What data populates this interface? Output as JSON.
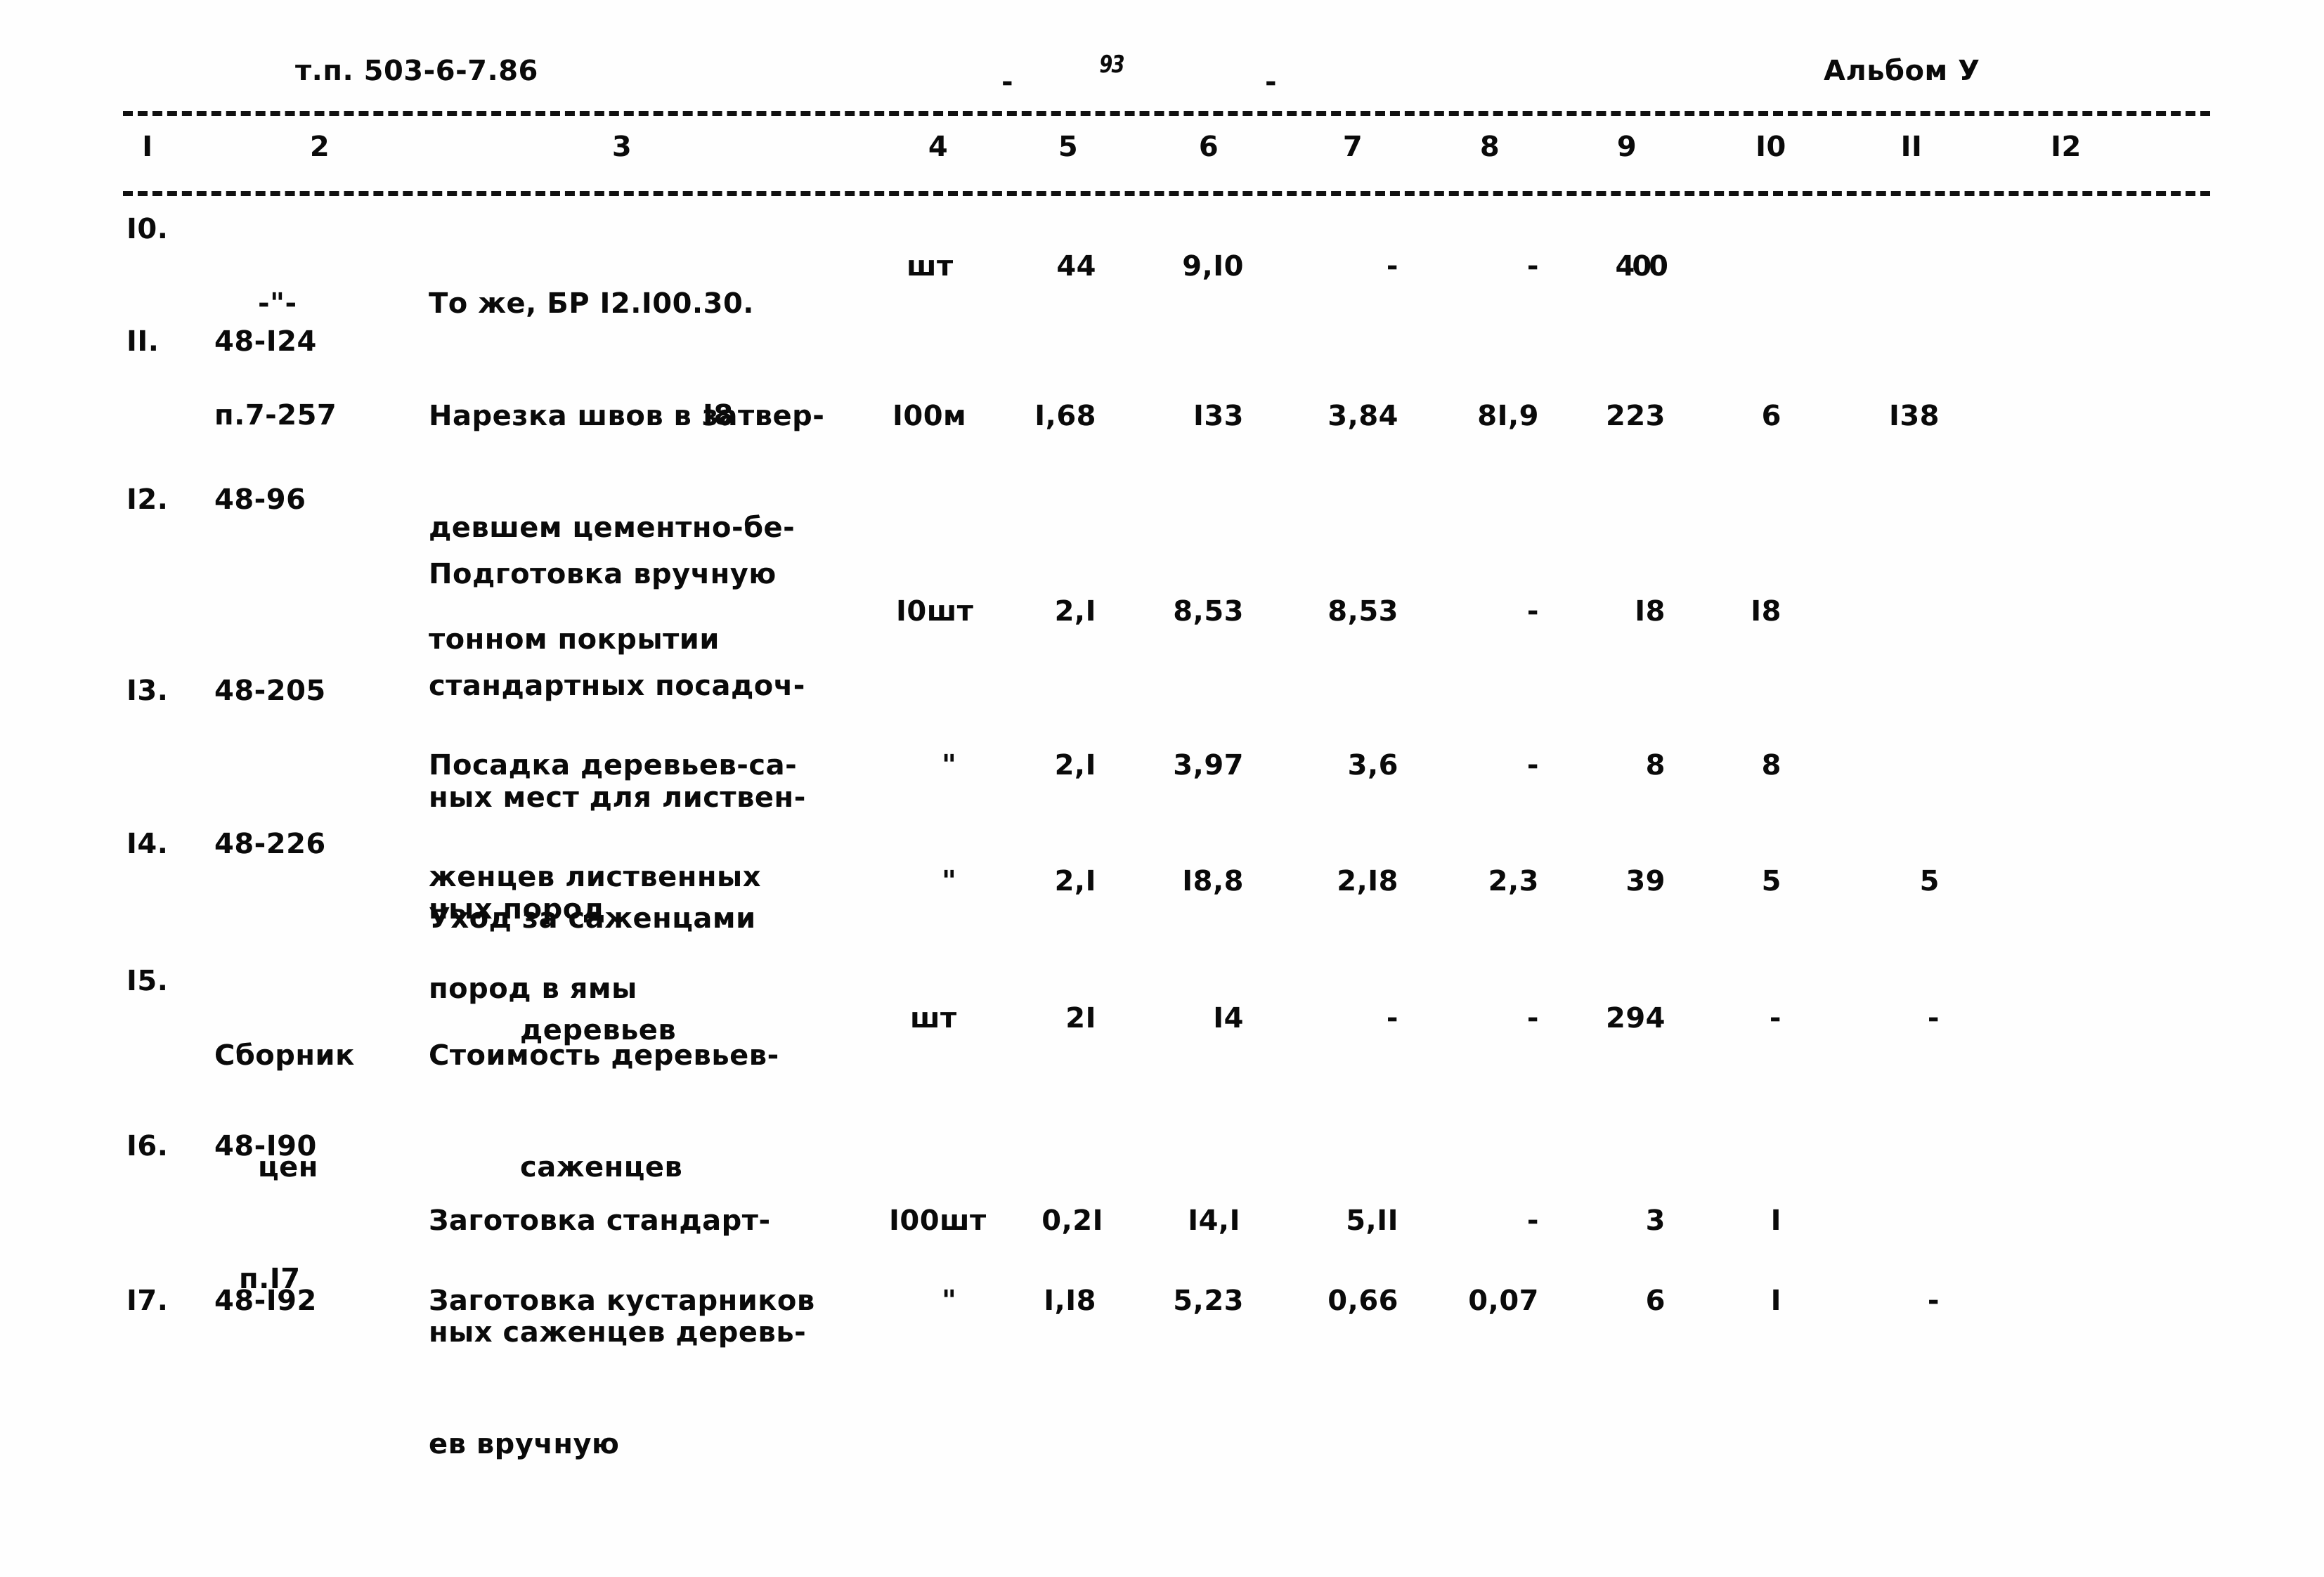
{
  "header": {
    "doc_code": "т.п. 503-6-7.86",
    "dash_left": "-",
    "page_number": "93",
    "dash_right": "-",
    "album": "Альбом У"
  },
  "table": {
    "column_numbers": [
      "I",
      "2",
      "3",
      "4",
      "5",
      "6",
      "7",
      "8",
      "9",
      "I0",
      "II",
      "I2"
    ],
    "rows": [
      {
        "num": "I0.",
        "code_line1": "-\"-",
        "code_line2": "п.7-257",
        "name_line1": "То же, БР I2.I00.30.",
        "name_line2": "I8",
        "unit": "шт",
        "c5": "44",
        "c6": "9,I0",
        "c7": "-",
        "c8": "-",
        "c9": "400",
        "c10": "",
        "c11": "",
        "c12": ""
      },
      {
        "num": "II.",
        "code_line1": "48-I24",
        "code_line2": "",
        "name_line1": "Нарезка швов в затвер-",
        "name_line2": "девшем цементно-бе-",
        "name_line3": "тонном покрытии",
        "unit": "I00м",
        "c5": "I,68",
        "c6": "I33",
        "c7": "3,84",
        "c8": "8I,9",
        "c9": "223",
        "c10": "6",
        "c11": "I38",
        "c12": ""
      },
      {
        "num": "I2.",
        "code_line1": "48-96",
        "code_line2": "",
        "name_line1": "Подготовка вручную",
        "name_line2": "стандартных посадоч-",
        "name_line3": "ных мест для листвен-",
        "name_line4": "ных пород",
        "unit": "I0шт",
        "c5": "2,I",
        "c6": "8,53",
        "c7": "8,53",
        "c8": "-",
        "c9": "I8",
        "c10": "I8",
        "c11": "",
        "c12": ""
      },
      {
        "num": "I3.",
        "code_line1": "48-205",
        "code_line2": "",
        "name_line1": "Посадка деревьев-са-",
        "name_line2": "женцев лиственных",
        "name_line3": "пород в ямы",
        "unit": "\"",
        "c5": "2,I",
        "c6": "3,97",
        "c7": "3,6",
        "c8": "-",
        "c9": "8",
        "c10": "8",
        "c11": "",
        "c12": ""
      },
      {
        "num": "I4.",
        "code_line1": "48-226",
        "code_line2": "",
        "name_line1": "Уход за саженцами",
        "name_line2": "деревьев",
        "unit": "\"",
        "c5": "2,I",
        "c6": "I8,8",
        "c7": "2,I8",
        "c8": "2,3",
        "c9": "39",
        "c10": "5",
        "c11": "5",
        "c12": ""
      },
      {
        "num": "I5.",
        "code_line1": "Сборник",
        "code_line2": "цен",
        "code_line3": "п.I7",
        "name_line1": "Стоимость деревьев-",
        "name_line2": "саженцев",
        "unit": "шт",
        "c5": "2I",
        "c6": "I4",
        "c7": "-",
        "c8": "-",
        "c9": "294",
        "c10": "-",
        "c11": "-",
        "c12": ""
      },
      {
        "num": "I6.",
        "code_line1": "48-I90",
        "code_line2": "",
        "name_line1": "Заготовка стандарт-",
        "name_line2": "ных саженцев деревь-",
        "name_line3": "ев вручную",
        "unit": "I00шт",
        "c5": "0,2I",
        "c6": "I4,I",
        "c7": "5,II",
        "c8": "-",
        "c9": "3",
        "c10": "I",
        "c11": "",
        "c12": ""
      },
      {
        "num": "I7.",
        "code_line1": "48-I92",
        "code_line2": "",
        "name_line1": "Заготовка кустарников",
        "unit": "\"",
        "c5": "I,I8",
        "c6": "5,23",
        "c7": "0,66",
        "c8": "0,07",
        "c9": "6",
        "c10": "I",
        "c11": "-",
        "c12": ""
      }
    ]
  }
}
